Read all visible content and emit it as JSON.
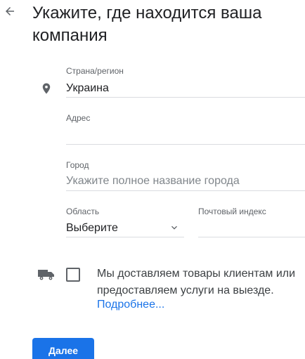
{
  "header": {
    "back_icon": "arrow-back-icon",
    "title": "Укажите, где находится ваша компания"
  },
  "form": {
    "country": {
      "label": "Страна/регион",
      "value": "Украина",
      "icon": "location-pin-icon"
    },
    "address": {
      "label": "Адрес",
      "value": ""
    },
    "city": {
      "label": "Город",
      "placeholder": "Укажите полное название города"
    },
    "region": {
      "label": "Область",
      "value": "Выберите",
      "icon": "chevron-down-icon"
    },
    "postal_code": {
      "label": "Почтовый индекс",
      "value": ""
    }
  },
  "delivery": {
    "icon": "truck-icon",
    "checked": false,
    "text": "Мы доставляем товары клиентам или предоставляем услуги на выезде.",
    "link": "Подробнее..."
  },
  "actions": {
    "next_label": "Далее"
  },
  "colors": {
    "primary": "#1a73e8",
    "text": "#202124",
    "secondary_text": "#5f6368",
    "divider": "#dadce0",
    "icon": "#5f6368"
  }
}
